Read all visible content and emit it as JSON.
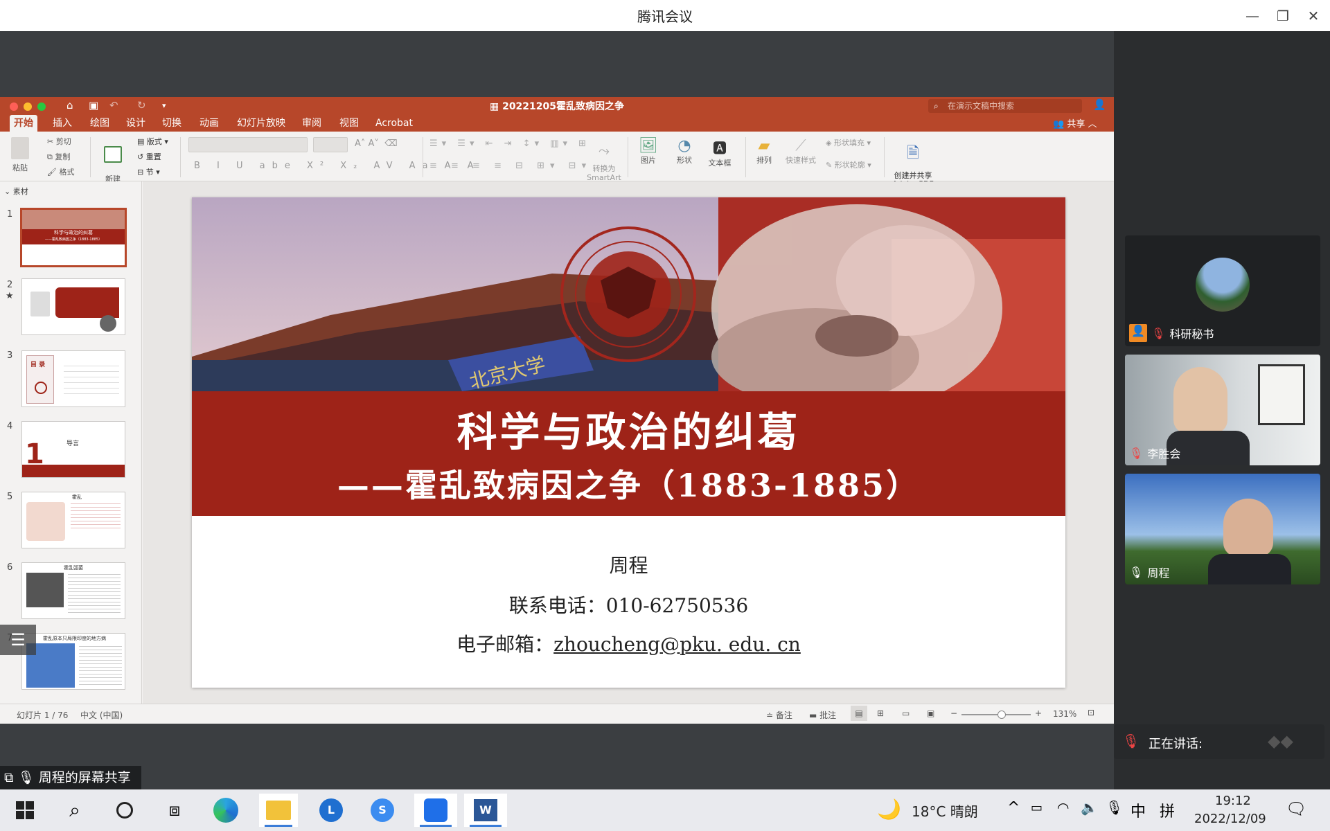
{
  "window": {
    "title": "腾讯会议"
  },
  "ppt": {
    "doc_title": "20221205霍乱致病因之争",
    "search_placeholder": "在演示文稿中搜索",
    "share_label": "共享",
    "tabs": [
      "开始",
      "插入",
      "绘图",
      "设计",
      "切换",
      "动画",
      "幻灯片放映",
      "审阅",
      "视图",
      "Acrobat"
    ],
    "ribbon": {
      "paste": "粘贴",
      "cut": "剪切",
      "copy": "复制",
      "format": "格式",
      "new_slide": "新建\n幻灯片",
      "layout": "版式",
      "reset": "重置",
      "section": "节",
      "smartart": "转换为\nSmartArt",
      "picture": "图片",
      "shape": "形状",
      "textbox": "文本框",
      "arrange": "排列",
      "quick_style": "快速样式",
      "shape_fill": "形状填充",
      "shape_outline": "形状轮廓",
      "create_pdf": "创建并共享\nAdobe PDF"
    },
    "section_label": "素材",
    "thumbnails": [
      "1",
      "2",
      "3",
      "4",
      "5",
      "6",
      "7"
    ],
    "status": {
      "slide_of": "幻灯片 1 / 76",
      "language": "中文 (中国)",
      "notes": "备注",
      "comments": "批注",
      "zoom": "131%"
    }
  },
  "slide": {
    "title": "科学与政治的纠葛",
    "subtitle": "——霍乱致病因之争（1883-1885）",
    "author": "周程",
    "phone": "联系电话：010-62750536",
    "email_label": "电子邮箱：",
    "email": "zhoucheng@pku. edu. cn",
    "thumb1_title": "科学与政治的纠葛",
    "thumb1_sub": "——霍乱致病因之争（1883-1885）",
    "thumb3_title": "目 录",
    "thumb4_num": "1",
    "thumb4_title": "导言",
    "thumb5_title": "霍乱",
    "thumb6_title": "霍乱弧菌",
    "thumb7_title": "霍乱原本只局限印度的地方病"
  },
  "participants": [
    {
      "name": "科研秘书"
    },
    {
      "name": "李胜会"
    },
    {
      "name": "周程"
    }
  ],
  "speaking": {
    "label": "正在讲话:"
  },
  "share_tag": {
    "label": "周程的屏幕共享"
  },
  "taskbar": {
    "weather": "18°C  晴朗",
    "ime": "中",
    "ime2": "拼",
    "time": "19:12",
    "date": "2022/12/09"
  },
  "colors": {
    "ppt_accent": "#b7472a",
    "slide_band": "#9e2318"
  }
}
